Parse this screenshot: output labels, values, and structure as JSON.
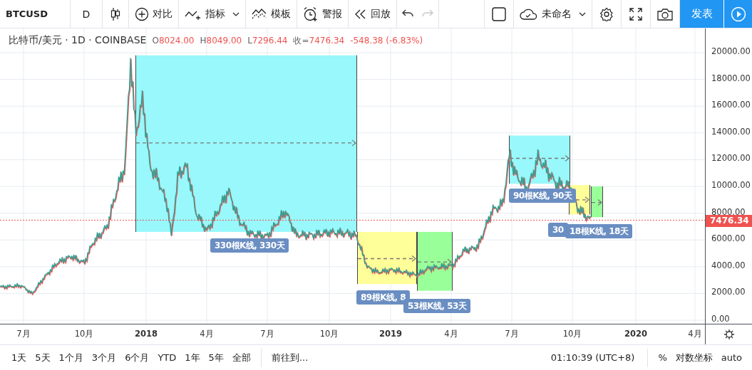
{
  "toolbar": {
    "symbol": "BTCUSD",
    "interval": "D",
    "compare": "对比",
    "indicators": "指标",
    "templates": "模板",
    "alerts": "警报",
    "replay": "回放",
    "undo": {
      "disabled": false
    },
    "redo": {
      "disabled": true
    },
    "layout_name": "未命名",
    "publish": "发表"
  },
  "legend": {
    "title": "比特币/美元 · 1D · COINBASE",
    "values": [
      {
        "key": "O",
        "value": "8024.00"
      },
      {
        "key": "H",
        "value": "8049.00"
      },
      {
        "key": "L",
        "value": "7296.44"
      },
      {
        "key": "收=",
        "value": "7476.34"
      }
    ],
    "change": "-548.38 (-6.83%)"
  },
  "projections": [
    {
      "color": "#98f8fb",
      "label": "330根K线, 330天"
    },
    {
      "color": "#ffff99",
      "label": "89根K线, 8"
    },
    {
      "color": "#99ff99",
      "label": "53根K线, 53天"
    },
    {
      "color": "#98f8fb",
      "label": "90根K线, 90天"
    },
    {
      "color": "#ffff99",
      "label": "30"
    },
    {
      "color": "#99ff99",
      "label": "18根K线, 18天"
    }
  ],
  "y_axis": {
    "labels": [
      "20000.00",
      "18000.00",
      "16000.00",
      "14000.00",
      "12000.00",
      "10000.00",
      "8000.00",
      "6000.00",
      "4000.00",
      "2000.00",
      "0.00"
    ],
    "price_tag": "7476.34"
  },
  "x_axis": {
    "labels": [
      {
        "text": "7月",
        "kind": "month"
      },
      {
        "text": "10月",
        "kind": "month"
      },
      {
        "text": "2018",
        "kind": "year"
      },
      {
        "text": "4月",
        "kind": "month"
      },
      {
        "text": "7月",
        "kind": "month"
      },
      {
        "text": "10月",
        "kind": "month"
      },
      {
        "text": "2019",
        "kind": "year"
      },
      {
        "text": "4月",
        "kind": "month"
      },
      {
        "text": "7月",
        "kind": "month"
      },
      {
        "text": "10月",
        "kind": "month"
      },
      {
        "text": "2020",
        "kind": "year"
      },
      {
        "text": "4月",
        "kind": "month"
      }
    ]
  },
  "bottom_bar": {
    "ranges": [
      "1天",
      "5天",
      "1个月",
      "3个月",
      "6个月",
      "YTD",
      "1年",
      "5年",
      "全部"
    ],
    "goto": "前往到...",
    "time": "01:10:39 (UTC+8)",
    "percent": "%",
    "log_scale": "对数坐标",
    "auto": "auto"
  }
}
